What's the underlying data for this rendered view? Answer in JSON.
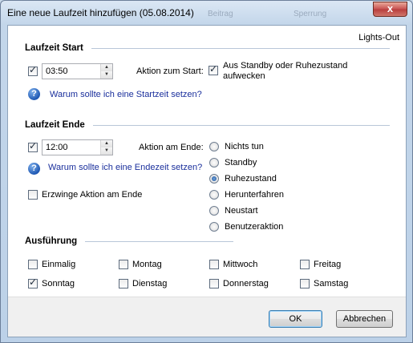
{
  "window": {
    "title": "Eine neue Laufzeit hinzufügen (05.08.2014)",
    "background_text_1": "Beitrag",
    "background_text_2": "Sperrung",
    "close_symbol": "x"
  },
  "header": {
    "app_name": "Lights-Out"
  },
  "start": {
    "section_title": "Laufzeit Start",
    "enabled": true,
    "time": "03:50",
    "action_label": "Aktion zum Start:",
    "wake_label_line1": "Aus Standby oder Ruhezustand",
    "wake_label_line2": "aufwecken",
    "wake_checked": true,
    "help_link": "Warum sollte ich eine Startzeit setzen?"
  },
  "end": {
    "section_title": "Laufzeit Ende",
    "enabled": true,
    "time": "12:00",
    "action_label": "Aktion am Ende:",
    "help_link": "Warum sollte ich eine Endezeit setzen?",
    "force_label": "Erzwinge Aktion am Ende",
    "force_checked": false,
    "actions": [
      {
        "label": "Nichts tun",
        "selected": false
      },
      {
        "label": "Standby",
        "selected": false
      },
      {
        "label": "Ruhezustand",
        "selected": true
      },
      {
        "label": "Herunterfahren",
        "selected": false
      },
      {
        "label": "Neustart",
        "selected": false
      },
      {
        "label": "Benutzeraktion",
        "selected": false
      }
    ]
  },
  "execution": {
    "section_title": "Ausführung",
    "days": [
      {
        "label": "Einmalig",
        "checked": false
      },
      {
        "label": "Montag",
        "checked": false
      },
      {
        "label": "Mittwoch",
        "checked": false
      },
      {
        "label": "Freitag",
        "checked": false
      },
      {
        "label": "Sonntag",
        "checked": true
      },
      {
        "label": "Dienstag",
        "checked": false
      },
      {
        "label": "Donnerstag",
        "checked": false
      },
      {
        "label": "Samstag",
        "checked": false
      }
    ]
  },
  "buttons": {
    "ok": "OK",
    "cancel": "Abbrechen"
  },
  "icons": {
    "help": "help-icon",
    "close": "close-icon",
    "spin_up": "spin-up-icon",
    "spin_down": "spin-down-icon"
  },
  "colors": {
    "link": "#1a2f9c",
    "close_button": "#c75050",
    "frame": "#c3d6ea"
  }
}
